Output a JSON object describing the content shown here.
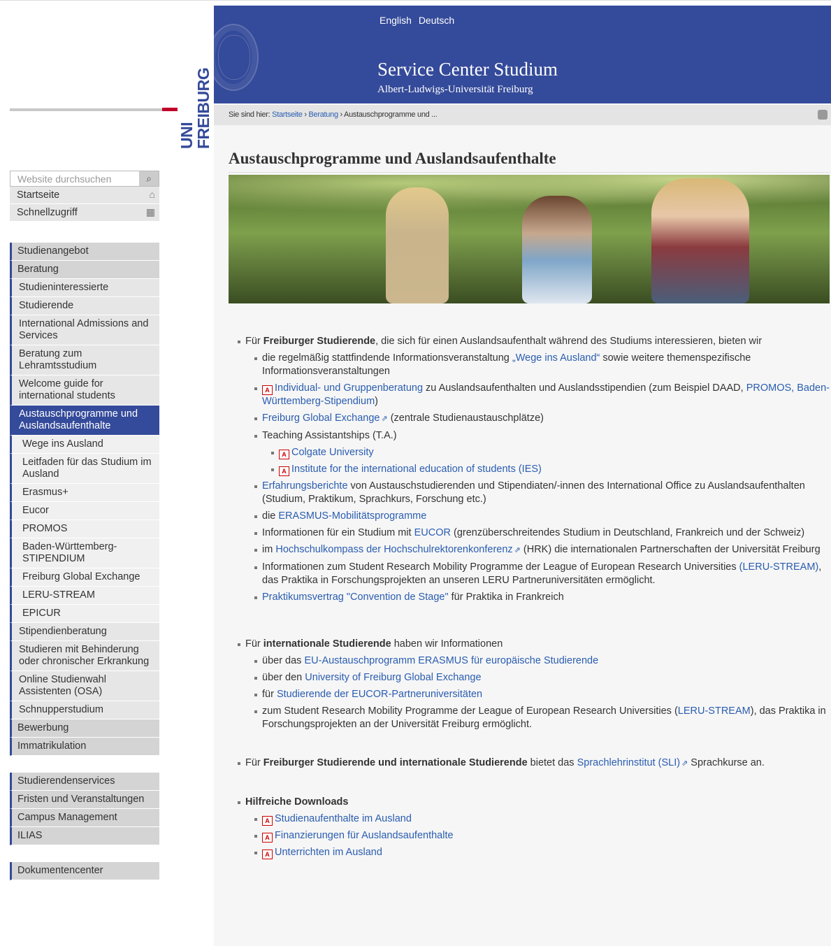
{
  "header": {
    "lang": [
      "English",
      "Deutsch"
    ],
    "title": "Service Center Studium",
    "subtitle": "Albert-Ludwigs-Universität Freiburg",
    "logo_uni": "UNI",
    "logo_freiburg": "FREIBURG"
  },
  "breadcrumb": {
    "prefix": "Sie sind hier: ",
    "items": [
      "Startseite",
      "Beratung"
    ],
    "sep": " › ",
    "current": "Austauschprogramme und ..."
  },
  "page_title": "Austauschprogramme und Auslandsaufenthalte",
  "sidebar": {
    "search_placeholder": "Website durchsuchen",
    "quick": [
      {
        "label": "Startseite",
        "icon": "home-icon"
      },
      {
        "label": "Schnellzugriff",
        "icon": "grid-icon"
      }
    ],
    "groups": [
      [
        {
          "label": "Studienangebot",
          "level": 1
        },
        {
          "label": "Beratung",
          "level": 1
        },
        {
          "label": "Studieninteressierte",
          "level": 2
        },
        {
          "label": "Studierende",
          "level": 2
        },
        {
          "label": "International Admissions and Services",
          "level": 2
        },
        {
          "label": "Beratung zum Lehramtsstudium",
          "level": 2
        },
        {
          "label": "Welcome guide for international students",
          "level": 2
        },
        {
          "label": "Austauschprogramme und Auslandsaufenthalte",
          "level": 2,
          "active": true
        },
        {
          "label": "Wege ins Ausland",
          "level": 3
        },
        {
          "label": "Leitfaden für das Studium im Ausland",
          "level": 3
        },
        {
          "label": "Erasmus+",
          "level": 3
        },
        {
          "label": "Eucor",
          "level": 3
        },
        {
          "label": "PROMOS",
          "level": 3
        },
        {
          "label": "Baden-Württemberg-STIPENDIUM",
          "level": 3
        },
        {
          "label": "Freiburg Global Exchange",
          "level": 3
        },
        {
          "label": "LERU-STREAM",
          "level": 3
        },
        {
          "label": "EPICUR",
          "level": 3
        },
        {
          "label": "Stipendienberatung",
          "level": 2
        },
        {
          "label": "Studieren mit Behinderung oder chronischer Erkrankung",
          "level": 2
        },
        {
          "label": "Online Studienwahl Assistenten (OSA)",
          "level": 2
        },
        {
          "label": "Schnupperstudium",
          "level": 2
        },
        {
          "label": "Bewerbung",
          "level": 1
        },
        {
          "label": "Immatrikulation",
          "level": 1
        }
      ],
      [
        {
          "label": "Studierendenservices",
          "level": 1
        },
        {
          "label": "Fristen und Veranstaltungen",
          "level": 1
        },
        {
          "label": "Campus Management",
          "level": 1
        },
        {
          "label": "ILIAS",
          "level": 1
        }
      ],
      [
        {
          "label": "Dokumentencenter",
          "level": 1
        }
      ]
    ]
  },
  "content": {
    "s1": {
      "a": "Für ",
      "b": "Freiburger Studierende",
      "c": ", die sich für einen Auslandsaufenthalt während des Studiums interessieren, bieten wir",
      "i1": {
        "a": "die regelmäßig stattfindende Informationsveranstaltung ",
        "link": "„Wege ins Ausland“",
        "b": " sowie weitere themenspezifische Informationsveranstaltungen"
      },
      "i2": {
        "link": "Individual- und Gruppenberatung",
        "b": " zu Auslandsaufenthalten und Auslandsstipendien (zum Beispiel DAAD, ",
        "link2": "PROMOS, Baden-Württemberg-Stipendium",
        "c": ")"
      },
      "i3": {
        "link": "Freiburg Global Exchange",
        "b": " (zentrale Studienaustauschplätze)"
      },
      "i4": {
        "a": "Teaching Assistantships (T.A.)",
        "sub": [
          "Colgate University",
          "Institute for the international education of students (IES)"
        ]
      },
      "i5": {
        "link": "Erfahrungsberichte",
        "b": " von Austauschstudierenden und Stipendiaten/-innen des International Office zu Auslandsaufenthalten (Studium, Praktikum, Sprachkurs, Forschung etc.)"
      },
      "i6": {
        "a": "die ",
        "link": "ERASMUS-Mobilitätsprogramme"
      },
      "i7": {
        "a": "Informationen für ein Studium mit ",
        "link": "EUCOR",
        "b": " (grenzüberschreitendes Studium in Deutschland, Frankreich und der Schweiz)"
      },
      "i8": {
        "a": "im ",
        "link": "Hochschulkompass der Hochschulrektorenkonferenz",
        "b": " (HRK) die internationalen Partnerschaften der Universität Freiburg"
      },
      "i9": {
        "a": "Informationen zum Student Research Mobility Programme der League of European Research Universities ",
        "link": "(LERU-STREAM)",
        "b": ", das Praktika in Forschungsprojekten an unseren LERU Partneruniversitäten ermöglicht."
      },
      "i10": {
        "link": "Praktikumsvertrag \"Convention de Stage\"",
        "b": " für Praktika in Frankreich"
      }
    },
    "s2": {
      "a": "Für ",
      "b": "internationale Studierende",
      "c": " haben wir Informationen",
      "i1": {
        "a": "über das ",
        "link": "EU-Austauschprogramm ERASMUS für europäische Studierende"
      },
      "i2": {
        "a": "über den ",
        "link": "University of Freiburg Global Exchange"
      },
      "i3": {
        "a": "für ",
        "link": "Studierende der EUCOR-Partneruniversitäten"
      },
      "i4": {
        "a": "zum Student Research Mobility Programme der League of European Research Universities (",
        "link": "LERU-STREAM",
        "b": "), das Praktika in Forschungsprojekten an der Universität Freiburg ermöglicht."
      }
    },
    "s3": {
      "a": "Für ",
      "b": "Freiburger Studierende und internationale Studierende",
      "c": " bietet das ",
      "link": "Sprachlehrinstitut (SLI)",
      "d": " Sprachkurse an."
    },
    "s4": {
      "title": "Hilfreiche Downloads",
      "items": [
        "Studienaufenthalte im Ausland",
        "Finanzierungen für Auslandsaufenthalte",
        "Unterrichten im Ausland"
      ]
    }
  }
}
